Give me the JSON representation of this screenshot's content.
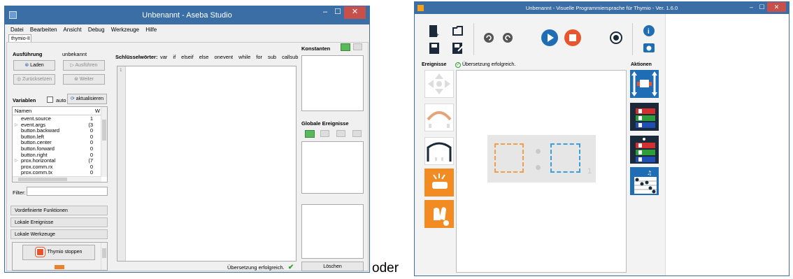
{
  "left_window": {
    "title": "Unbenannt - Aseba Studio",
    "menu": [
      "Datei",
      "Bearbeiten",
      "Ansicht",
      "Debug",
      "Werkzeuge",
      "Hilfe"
    ],
    "tab": "thymio-II",
    "execution": {
      "label": "Ausführung",
      "status": "unbekannt",
      "load": "Laden",
      "run": "Ausführen",
      "reset": "Zurücksetzen",
      "next": "Weiter"
    },
    "variables": {
      "label": "Variablen",
      "auto_label": "auto",
      "refresh": "aktualisieren",
      "col_name": "Namen",
      "col_value": "W",
      "items": [
        {
          "name": "event.source",
          "value": "1",
          "expand": false
        },
        {
          "name": "event.args",
          "value": "(3",
          "expand": true
        },
        {
          "name": "button.backward",
          "value": "0",
          "expand": false
        },
        {
          "name": "button.left",
          "value": "0",
          "expand": false
        },
        {
          "name": "button.center",
          "value": "0",
          "expand": false
        },
        {
          "name": "button.forward",
          "value": "0",
          "expand": false
        },
        {
          "name": "button.right",
          "value": "0",
          "expand": false
        },
        {
          "name": "prox.horizontal",
          "value": "(7",
          "expand": true
        },
        {
          "name": "prox.comm.rx",
          "value": "0",
          "expand": false
        },
        {
          "name": "prox.comm.tx",
          "value": "0",
          "expand": false
        }
      ],
      "filter_label": "Filter:"
    },
    "bottom_bars": [
      "Vordefinierte Funktionen",
      "Lokale Ereignisse",
      "Lokale Werkzeuge"
    ],
    "stop_button": "Thymio stoppen",
    "keywords": {
      "label": "Schlüsselwörter:",
      "items": [
        "var",
        "if",
        "elseif",
        "else",
        "onevent",
        "while",
        "for",
        "sub",
        "callsub"
      ]
    },
    "line_number": "1",
    "compile_status": "Übersetzung erfolgreich.",
    "constants_label": "Konstanten",
    "global_events_label": "Globale Ereignisse",
    "clear_button": "Löschen",
    "colors": {
      "titlebar": "#3b6ea5",
      "close": "#c7504b",
      "check": "#2ea12e"
    }
  },
  "connector_text": "oder",
  "right_window": {
    "title": "Unbenannt - Visuelle Programmiersprache für Thymio - Ver. 1.6.0",
    "events_label": "Ereignisse",
    "compile_status": "Übersetzung erfolgreich.",
    "actions_label": "Aktionen",
    "event_pair_number": "1",
    "icons": [
      "new-file",
      "open-folder",
      "save",
      "save-as",
      "undo",
      "redo",
      "run",
      "stop",
      "advanced-mode",
      "info",
      "screenshot"
    ],
    "colors": {
      "orange": "#f28c22",
      "blue": "#1f6db5",
      "dark": "#1b2a3a",
      "dashed_orange": "#f0a048",
      "dashed_blue": "#3aa0dd"
    }
  }
}
